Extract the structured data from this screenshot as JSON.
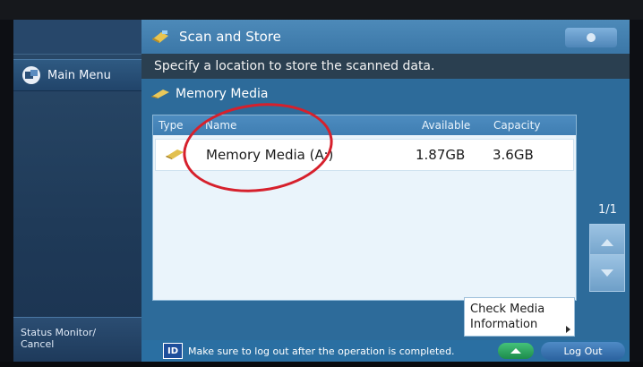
{
  "sidebar": {
    "main_menu_label": "Main Menu",
    "status_label_line1": "Status Monitor/",
    "status_label_line2": "Cancel"
  },
  "header": {
    "title": "Scan and Store"
  },
  "instruction": "Specify a location to store the scanned data.",
  "section": {
    "title": "Memory Media"
  },
  "table": {
    "columns": [
      "Type",
      "Name",
      "Available",
      "Capacity"
    ],
    "rows": [
      {
        "name": "Memory Media (A:)",
        "available": "1.87GB",
        "capacity": "3.6GB"
      }
    ]
  },
  "pagination": {
    "page": "1/1"
  },
  "buttons": {
    "check_media_line1": "Check Media",
    "check_media_line2": "Information",
    "logout": "Log Out"
  },
  "footer": {
    "id_label": "ID",
    "message": "Make sure to log out after the operation is completed."
  },
  "colors": {
    "annotation_circle": "#d6202c",
    "title_bar": "#4d8ab9",
    "main_panel": "#2d6b9a",
    "eject_button": "#1d8c4b"
  },
  "icons": [
    "main-menu-icon",
    "scan-store-icon",
    "memory-media-icon",
    "usb-drive-icon",
    "eject-icon",
    "scroll-up-icon",
    "scroll-down-icon"
  ]
}
